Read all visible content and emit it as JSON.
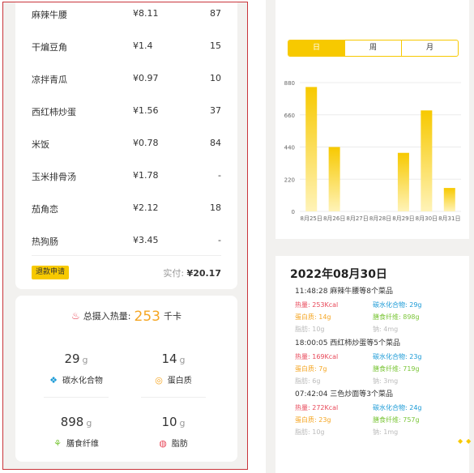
{
  "order": {
    "dishes": [
      {
        "name": "麻辣牛腰",
        "price": "¥8.11",
        "qty": "87"
      },
      {
        "name": "干煸豆角",
        "price": "¥1.4",
        "qty": "15"
      },
      {
        "name": "凉拌青瓜",
        "price": "¥0.97",
        "qty": "10"
      },
      {
        "name": "西红柿炒蛋",
        "price": "¥1.56",
        "qty": "37"
      },
      {
        "name": "米饭",
        "price": "¥0.78",
        "qty": "84"
      },
      {
        "name": "玉米排骨汤",
        "price": "¥1.78",
        "qty": "-"
      },
      {
        "name": "茄角恋",
        "price": "¥2.12",
        "qty": "18"
      },
      {
        "name": "热狗肠",
        "price": "¥3.45",
        "qty": "-"
      }
    ],
    "refund_label": "退款申请",
    "paid_label": "实付:",
    "paid_amount": "¥20.17"
  },
  "nutrition": {
    "total_label": "总摄入热量:",
    "total_value": "253",
    "total_unit": "千卡",
    "items": [
      {
        "value": "29",
        "unit": "g",
        "label": "碳水化合物",
        "icon": "carb-icon",
        "color": "#1a9ad6"
      },
      {
        "value": "14",
        "unit": "g",
        "label": "蛋白质",
        "icon": "protein-icon",
        "color": "#f5a623"
      },
      {
        "value": "898",
        "unit": "g",
        "label": "膳食纤维",
        "icon": "fiber-icon",
        "color": "#7cc63a"
      },
      {
        "value": "10",
        "unit": "g",
        "label": "脂肪",
        "icon": "fat-icon",
        "color": "#e8495a"
      }
    ]
  },
  "tabs": [
    {
      "label": "日",
      "active": true
    },
    {
      "label": "周",
      "active": false
    },
    {
      "label": "月",
      "active": false
    }
  ],
  "chart_data": {
    "type": "bar",
    "categories": [
      "8月25日",
      "8月26日",
      "8月27日",
      "8月28日",
      "8月29日",
      "8月30日",
      "8月31日"
    ],
    "values": [
      850,
      440,
      0,
      0,
      400,
      690,
      160
    ],
    "ylim": [
      0,
      880
    ],
    "yticks": [
      0,
      220,
      440,
      660,
      880
    ],
    "grid": true,
    "bar_color_top": "#f7c900",
    "bar_color_bottom": "#fff3b8"
  },
  "detail": {
    "date": "2022年08月30日",
    "entries": [
      {
        "head": "11:48:28  麻辣牛腰等8个菜品",
        "heat": "热量: 253Kcal",
        "carb": "碳水化合物: 29g",
        "protein": "蛋白质: 14g",
        "fiber": "膳食纤维: 898g",
        "fat": "脂肪: 10g",
        "sodium": "钠: 4mg"
      },
      {
        "head": "18:00:05  西红柿炒蛋等5个菜品",
        "heat": "热量: 169Kcal",
        "carb": "碳水化合物: 23g",
        "protein": "蛋白质: 7g",
        "fiber": "膳食纤维: 719g",
        "fat": "脂肪: 6g",
        "sodium": "钠: 3mg"
      },
      {
        "head": "07:42:04  三色炒面等3个菜品",
        "heat": "热量: 272Kcal",
        "carb": "碳水化合物: 24g",
        "protein": "蛋白质: 23g",
        "fiber": "膳食纤维: 757g",
        "fat": "脂肪: 10g",
        "sodium": "钠: 1mg"
      }
    ]
  }
}
